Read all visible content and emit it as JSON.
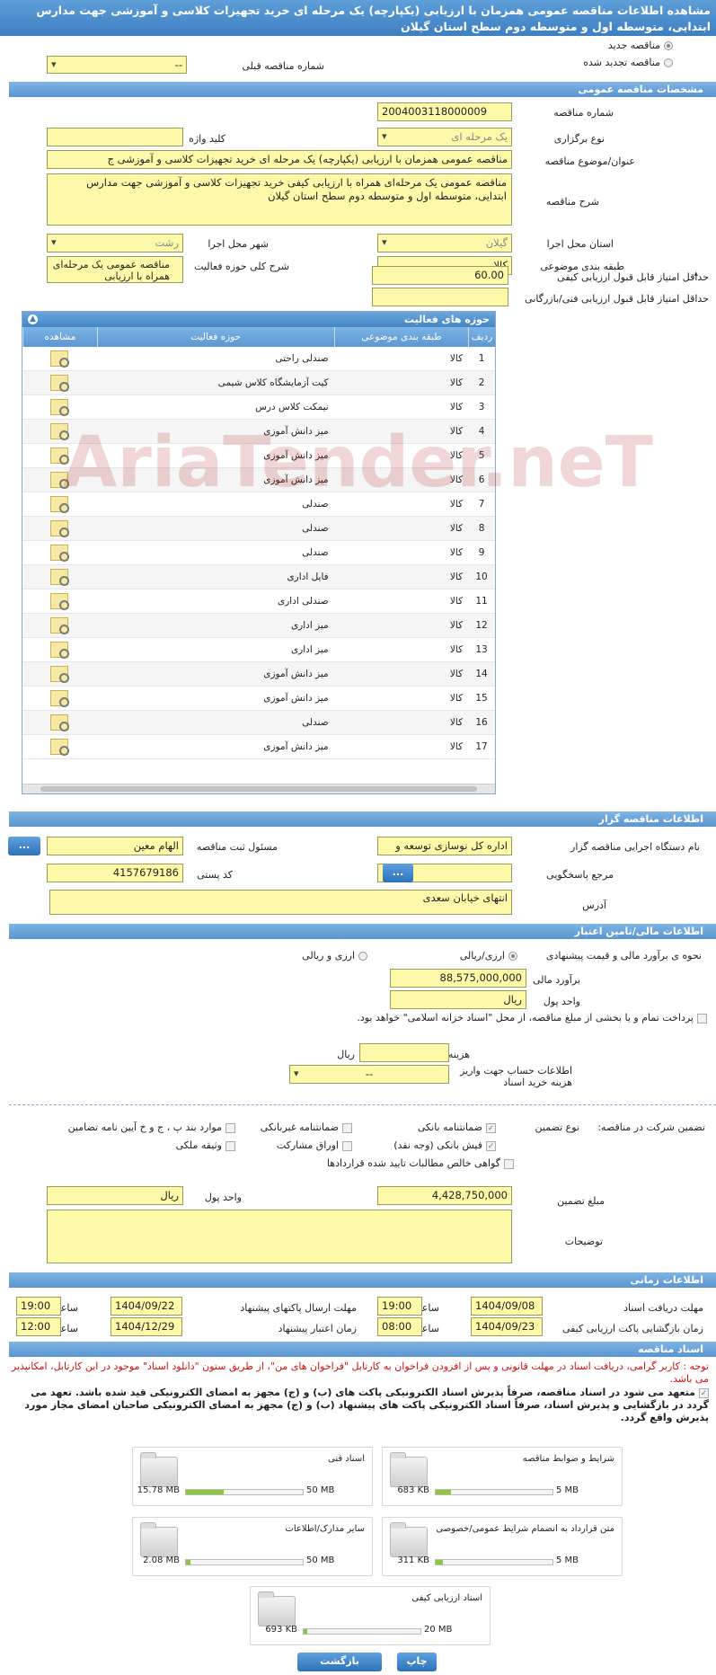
{
  "title": "مشاهده اطلاعات مناقصه عمومی همزمان با ارزیابی (یکپارچه) یک مرحله ای خرید تجهیزات کلاسی و آموزشی جهت مدارس ابتدایی، متوسطه اول و متوسطه دوم سطح استان گیلان",
  "top": {
    "new_tender": "مناقصه جدید",
    "renewed_tender": "مناقصه تجدید شده",
    "prev_number_label": "شماره مناقصه قبلی",
    "prev_number_value": "--"
  },
  "general": {
    "header": "مشخصات مناقصه عمومی",
    "number_label": "شماره مناقصه",
    "number_value": "2004003118000009",
    "type_label": "نوع برگزاری",
    "type_value": "یک مرحله ای",
    "keyword_label": "کلید واژه",
    "keyword_value": "",
    "subject_label": "عنوان/موضوع مناقصه",
    "subject_value": "مناقصه عمومی همزمان با ارزیابی (یکپارچه) یک مرحله ای خرید تجهیزات کلاسی و آموزشی ج",
    "desc_label": "شرح مناقصه",
    "desc_value": "مناقصه عمومی یک مرحله‌ای همراه با ارزیابی کیفی خرید تجهیزات کلاسی و آموزشی جهت مدارس ابتدایی، متوسطه اول و متوسطه دوم سطح استان گیلان",
    "province_label": "استان محل اجرا",
    "province_value": "گیلان",
    "city_label": "شهر محل اجرا",
    "city_value": "رشت",
    "category_label": "طبقه بندی موضوعی",
    "category_value": "کالا",
    "activity_label": "شرح کلی حوزه فعالیت",
    "activity_value": "مناقصه عمومی یک مرحله‌ای همراه با ارزیابی",
    "min_quality_label": "حداقل امتیاز قابل قبول ارزیابی کیفی",
    "min_quality_value": "60.00",
    "min_tech_label": "حداقل امتیاز قابل قبول ارزیابی فنی/بازرگانی",
    "min_tech_value": ""
  },
  "activities": {
    "header": "حوزه های فعالیت",
    "toggle": "▲",
    "col_row": "ردیف",
    "col_category": "طبقه بندی موضوعی",
    "col_field": "حوزه فعالیت",
    "col_view": "مشاهده",
    "rows": [
      {
        "n": "1",
        "cat": "کالا",
        "field": "صندلی راحتی"
      },
      {
        "n": "2",
        "cat": "کالا",
        "field": "کیت آزمایشگاه کلاس شیمی"
      },
      {
        "n": "3",
        "cat": "کالا",
        "field": "نیمکت کلاس درس"
      },
      {
        "n": "4",
        "cat": "کالا",
        "field": "میز دانش آموزی"
      },
      {
        "n": "5",
        "cat": "کالا",
        "field": "میز دانش آموزی"
      },
      {
        "n": "6",
        "cat": "کالا",
        "field": "میز دانش آموزی"
      },
      {
        "n": "7",
        "cat": "کالا",
        "field": "صندلی"
      },
      {
        "n": "8",
        "cat": "کالا",
        "field": "صندلی"
      },
      {
        "n": "9",
        "cat": "کالا",
        "field": "صندلی"
      },
      {
        "n": "10",
        "cat": "کالا",
        "field": "فایل اداری"
      },
      {
        "n": "11",
        "cat": "کالا",
        "field": "صندلی اداری"
      },
      {
        "n": "12",
        "cat": "کالا",
        "field": "میز اداری"
      },
      {
        "n": "13",
        "cat": "کالا",
        "field": "میز اداری"
      },
      {
        "n": "14",
        "cat": "کالا",
        "field": "میز دانش آموزی"
      },
      {
        "n": "15",
        "cat": "کالا",
        "field": "میز دانش آموزی"
      },
      {
        "n": "16",
        "cat": "کالا",
        "field": "صندلی"
      },
      {
        "n": "17",
        "cat": "کالا",
        "field": "میز دانش آموزی"
      }
    ]
  },
  "watermark": "AriaTender.neT",
  "organizer": {
    "header": "اطلاعات مناقصه گزار",
    "org_label": "نام دستگاه اجرایی مناقصه گزار",
    "org_value": "اداره کل نوسازی  توسعه و",
    "resp_label": "مسئول ثبت مناقصه",
    "resp_value": "الهام معین",
    "ref_label": "مرجع پاسخگویی",
    "ref_value": "",
    "postal_label": "کد پستی",
    "postal_value": "4157679186",
    "addr_label": "آدرس",
    "addr_value": "انتهای خیابان سعدی",
    "dots": "..."
  },
  "finance": {
    "header": "اطلاعات مالی/تامین اعتبار",
    "estimate_label": "نحوه ی برآورد مالی و قیمت پیشنهادی",
    "opt_rial": "ارزی/ریالی",
    "opt_rial2": "ارزی و ریالی",
    "amount_label": "برآورد مالی",
    "amount_value": "88,575,000,000",
    "unit_label": "واحد پول",
    "unit_value": "ریال",
    "treasury_text": "پرداخت تمام و یا بخشی از مبلغ مناقصه، از محل \"اسناد خزانه اسلامی\" خواهد بود.",
    "doc_cost_label": "هزینه خرید اسناد",
    "doc_cost_value": "",
    "doc_cost_unit": "ریال",
    "account_label": "اطلاعات حساب جهت واریز هزینه خرید اسناد",
    "account_value": "--"
  },
  "guarantee": {
    "participation_label": "تضمین شرکت در مناقصه:",
    "type_label": "نوع تضمین",
    "opt_bank": "ضمانتنامه بانکی",
    "opt_nonbank": "ضمانتنامه غیربانکی",
    "opt_clause": "موارد بند پ ، ج و خ آیین نامه تضامین",
    "opt_check": "فیش بانکی (وجه نقد)",
    "opt_bonds": "اوراق مشارکت",
    "opt_property": "وثیقه ملکی",
    "opt_claims": "گواهی خالص مطالبات تایید شده قراردادها",
    "amount_label": "مبلغ تضمین",
    "amount_value": "4,428,750,000",
    "unit_label": "واحد پول",
    "unit_value": "ریال",
    "notes_label": "توضیحات",
    "notes_value": ""
  },
  "timing": {
    "header": "اطلاعات زمانی",
    "receive_label": "مهلت دریافت اسناد",
    "receive_date": "1404/09/08",
    "receive_time": "19:00",
    "send_label": "مهلت ارسال پاکتهای پیشنهاد",
    "send_date": "1404/09/22",
    "send_time": "19:00",
    "open_label": "زمان بازگشایی پاکت ارزیابی کیفی",
    "open_date": "1404/09/23",
    "open_time": "08:00",
    "valid_label": "زمان اعتبار پیشنهاد",
    "valid_date": "1404/12/29",
    "valid_time": "12:00",
    "time_label": "ساعت"
  },
  "docs": {
    "header": "اسناد مناقصه",
    "notice": "توجه : کاربر گرامی، دریافت اسناد در مهلت قانونی و پس از افزودن فراخوان به کارتابل \"فراخوان های من\"، از طریق ستون \"دانلود اسناد\" موجود در این کارتابل، امکانپذیر می باشد.",
    "commit": "متعهد می شود در اسناد مناقصه، صرفاً پذیرش اسناد الکترونیکی پاکت های (ب) و (ج) مجهز به امضای الکترونیکی قید شده باشد. تعهد می گردد در بازگشایی و پذیرش اسناد، صرفاً اسناد الکترونیکی پاکت های پیشنهاد (ب) و (ج) مجهز به امضای الکترونیکی صاحبان امضای مجاز مورد پذیرش واقع گردد.",
    "files": [
      {
        "name": "شرایط و ضوابط مناقصه",
        "size": "683 KB",
        "max": "5 MB",
        "fill": 0.13
      },
      {
        "name": "اسناد فنی",
        "size": "15.78 MB",
        "max": "50 MB",
        "fill": 0.32
      },
      {
        "name": "متن قرارداد به انضمام شرایط عمومی/خصوصی",
        "size": "311 KB",
        "max": "5 MB",
        "fill": 0.06
      },
      {
        "name": "سایر مدارک/اطلاعات",
        "size": "2.08 MB",
        "max": "50 MB",
        "fill": 0.04
      },
      {
        "name": "اسناد ارزیابی کیفی",
        "size": "693 KB",
        "max": "20 MB",
        "fill": 0.03
      }
    ]
  },
  "footer": {
    "print": "چاپ",
    "back": "بازگشت"
  }
}
